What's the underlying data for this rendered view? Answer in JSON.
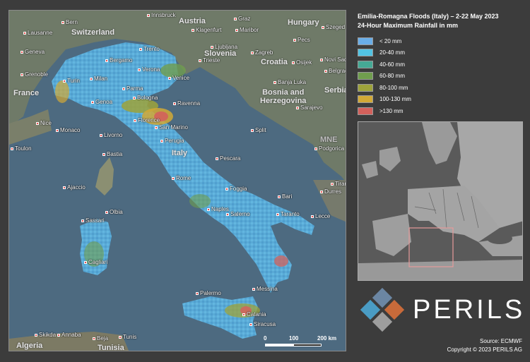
{
  "title": "Emilia-Romagna Floods (Italy) – 2-22 May 2023",
  "subtitle": "24-Hour Maximum Rainfall in mm",
  "legend": [
    {
      "label": "< 20 mm",
      "color": "#6aaee8"
    },
    {
      "label": "20-40 mm",
      "color": "#52c3e3"
    },
    {
      "label": "40-60 mm",
      "color": "#45a995"
    },
    {
      "label": "60-80 mm",
      "color": "#709e4e"
    },
    {
      "label": "80-100 mm",
      "color": "#9ea33b"
    },
    {
      "label": "100-130 mm",
      "color": "#d2a936"
    },
    {
      "label": ">130 mm",
      "color": "#d3615c"
    }
  ],
  "countries": {
    "austria": "Austria",
    "hungary": "Hungary",
    "switzerland": "Switzerland",
    "slovenia": "Slovenia",
    "croatia": "Croatia",
    "bosnia": "Bosnia and\nHerzegovina",
    "serbia": "Serbia",
    "france": "France",
    "mne": "MNE",
    "italy": "Italy",
    "algeria": "Algeria",
    "tunisia": "Tunisia"
  },
  "cities": {
    "innsbruck": "Innsbruck",
    "graz": "Graz",
    "bern": "Bern",
    "lausanne": "Lausanne",
    "klagenfurt": "Klagenfurt",
    "maribor": "Maribor",
    "pecs": "Pecs",
    "szeged": "Szeged",
    "geneva": "Geneva",
    "trento": "Trento",
    "ljubljana": "Ljubljana",
    "zagreb": "Zagreb",
    "novisad": "Novi Sad",
    "bergamo": "Bergamo",
    "verona": "Verona",
    "trieste": "Trieste",
    "osijek": "Osijek",
    "belgrade": "Belgrade",
    "grenoble": "Grenoble",
    "turin": "Turin",
    "milan": "Milan",
    "venice": "Venice",
    "parma": "Parma",
    "banjaluka": "Banja Luka",
    "genoa": "Genoa",
    "bologna": "Bologna",
    "ravenna": "Ravenna",
    "sarajevo": "Sarajevo",
    "nice": "Nice",
    "monaco": "Monaco",
    "florence": "Florence",
    "sanmarino": "San Marino",
    "split": "Split",
    "toulon": "Toulon",
    "livorno": "Livorno",
    "perugia": "Perugia",
    "podgorica": "Podgorica",
    "bastia": "Bastia",
    "pescara": "Pescara",
    "rome": "Rome",
    "ajaccio": "Ajaccio",
    "foggia": "Foggia",
    "tirana": "Tirana",
    "durres": "Durres",
    "bari": "Bari",
    "olbia": "Olbia",
    "naples": "Naples",
    "salerno": "Salerno",
    "taranto": "Taranto",
    "lecce": "Lecce",
    "sassari": "Sassari",
    "cagliari": "Cagliari",
    "palermo": "Palermo",
    "messina": "Messina",
    "catania": "Catania",
    "siracusa": "Siracusa",
    "skikda": "Skikda",
    "annaba": "Annaba",
    "beja": "Beja",
    "tunis": "Tunis"
  },
  "scale": {
    "t0": "0",
    "t1": "100",
    "t2": "200 km"
  },
  "logo_text": "PERILS",
  "source": "Source: ECMWF",
  "copyright": "Copyright © 2023 PERILS AG"
}
